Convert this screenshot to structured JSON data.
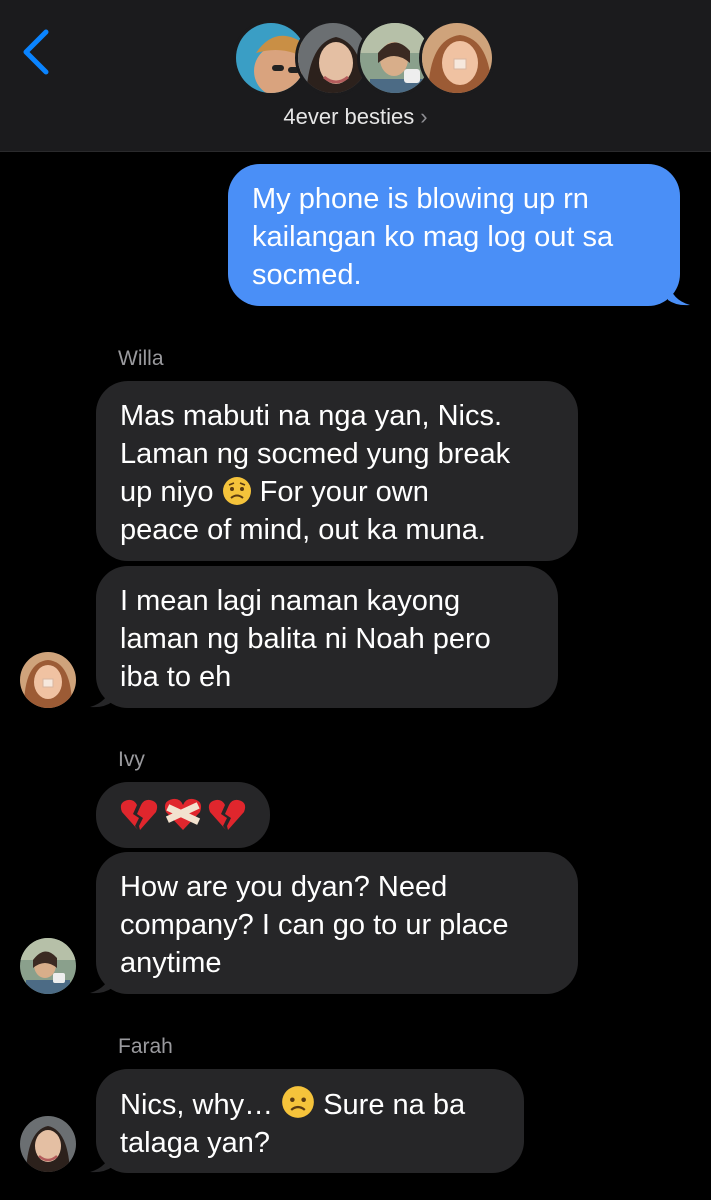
{
  "header": {
    "group_name": "4ever besties",
    "chevron": "›",
    "avatars": [
      "member-1-avatar",
      "member-2-avatar",
      "member-3-avatar",
      "member-4-avatar"
    ]
  },
  "messages": {
    "outgoing_1": [
      "My phone is blowing up rn",
      "kailangan ko mag log out sa",
      "socmed."
    ],
    "willa_name": "Willa",
    "willa_1": [
      "Mas mabuti na nga yan, Nics.",
      "Laman ng socmed yung break"
    ],
    "willa_1_line3_a": "up niyo",
    "willa_1_line3_b": "For your own",
    "willa_1_line4": "peace of mind, out ka muna.",
    "willa_2": [
      "I mean lagi naman kayong",
      "laman ng balita ni Noah pero",
      "iba to eh"
    ],
    "ivy_name": "Ivy",
    "ivy_1_emojis": "💔❤️‍🩹💔",
    "ivy_2": [
      "How are you dyan? Need",
      "company? I can go to ur place",
      "anytime"
    ],
    "farah_name": "Farah",
    "farah_1_a": "Nics, why…",
    "farah_1_b": "Sure na ba",
    "farah_1_line2": "talaga yan?"
  },
  "colors": {
    "outgoing_bubble": "#4a8ff7",
    "incoming_bubble": "#262628",
    "header_bg": "#1b1b1d",
    "accent": "#0a84ff"
  }
}
